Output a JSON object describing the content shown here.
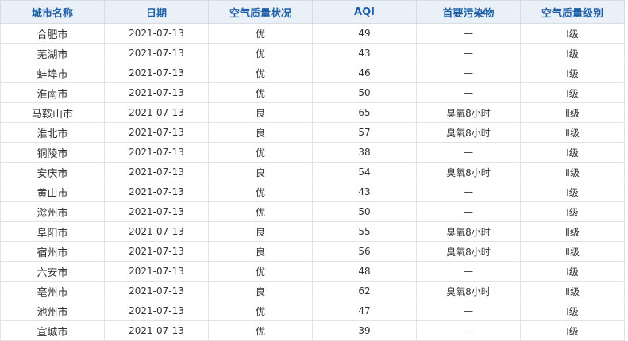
{
  "table": {
    "headers": [
      "城市名称",
      "日期",
      "空气质量状况",
      "AQI",
      "首要污染物",
      "空气质量级别"
    ],
    "rows": [
      [
        "合肥市",
        "2021-07-13",
        "优",
        "49",
        "—",
        "Ⅰ级"
      ],
      [
        "芜湖市",
        "2021-07-13",
        "优",
        "43",
        "—",
        "Ⅰ级"
      ],
      [
        "蚌埠市",
        "2021-07-13",
        "优",
        "46",
        "—",
        "Ⅰ级"
      ],
      [
        "淮南市",
        "2021-07-13",
        "优",
        "50",
        "—",
        "Ⅰ级"
      ],
      [
        "马鞍山市",
        "2021-07-13",
        "良",
        "65",
        "臭氧8小时",
        "Ⅱ级"
      ],
      [
        "淮北市",
        "2021-07-13",
        "良",
        "57",
        "臭氧8小时",
        "Ⅱ级"
      ],
      [
        "铜陵市",
        "2021-07-13",
        "优",
        "38",
        "—",
        "Ⅰ级"
      ],
      [
        "安庆市",
        "2021-07-13",
        "良",
        "54",
        "臭氧8小时",
        "Ⅱ级"
      ],
      [
        "黄山市",
        "2021-07-13",
        "优",
        "43",
        "—",
        "Ⅰ级"
      ],
      [
        "滁州市",
        "2021-07-13",
        "优",
        "50",
        "—",
        "Ⅰ级"
      ],
      [
        "阜阳市",
        "2021-07-13",
        "良",
        "55",
        "臭氧8小时",
        "Ⅱ级"
      ],
      [
        "宿州市",
        "2021-07-13",
        "良",
        "56",
        "臭氧8小时",
        "Ⅱ级"
      ],
      [
        "六安市",
        "2021-07-13",
        "优",
        "48",
        "—",
        "Ⅰ级"
      ],
      [
        "亳州市",
        "2021-07-13",
        "良",
        "62",
        "臭氧8小时",
        "Ⅱ级"
      ],
      [
        "池州市",
        "2021-07-13",
        "优",
        "47",
        "—",
        "Ⅰ级"
      ],
      [
        "宣城市",
        "2021-07-13",
        "优",
        "39",
        "—",
        "Ⅰ级"
      ]
    ]
  },
  "colors": {
    "header_bg": "#e9f0f8",
    "header_text": "#1f5fa6",
    "border": "#e3e3e3"
  }
}
